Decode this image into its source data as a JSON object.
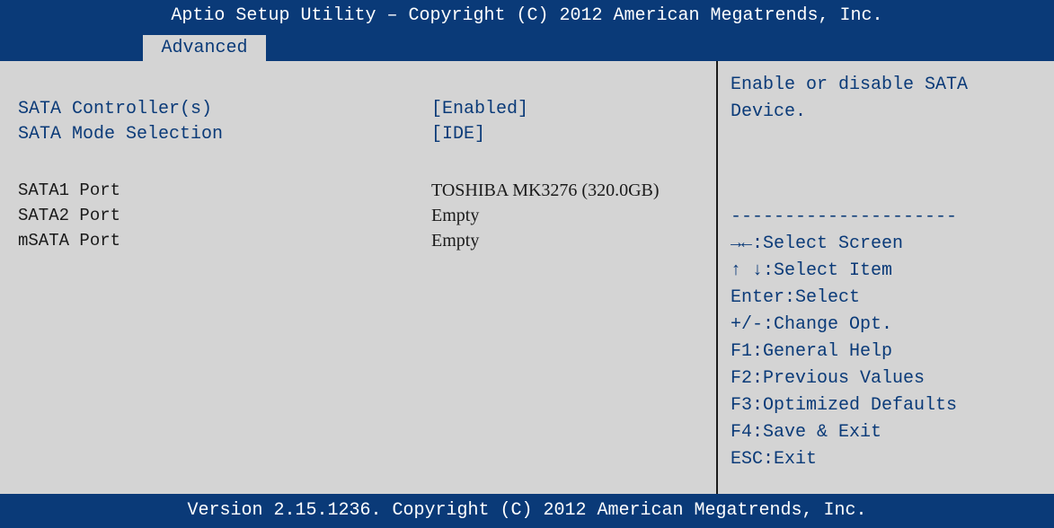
{
  "header": {
    "title": "Aptio Setup Utility – Copyright (C) 2012 American Megatrends, Inc."
  },
  "tabs": [
    {
      "label": "Advanced",
      "active": true
    }
  ],
  "settings": [
    {
      "label": "SATA Controller(s)",
      "value": "[Enabled]"
    },
    {
      "label": "SATA Mode Selection",
      "value": "[IDE]"
    }
  ],
  "ports": [
    {
      "label": "SATA1 Port",
      "value": "TOSHIBA MK3276 (320.0GB)"
    },
    {
      "label": "SATA2 Port",
      "value": "Empty"
    },
    {
      "label": "mSATA Port",
      "value": "Empty"
    }
  ],
  "help": {
    "text": "Enable or disable SATA\nDevice.",
    "separator": "---------------------",
    "keys": [
      {
        "key": "→←:",
        "desc": " Select Screen"
      },
      {
        "key": "↑ ↓:",
        "desc": " Select Item"
      },
      {
        "key": "Enter:",
        "desc": " Select"
      },
      {
        "key": "+/-:",
        "desc": "  Change Opt."
      },
      {
        "key": "F1:",
        "desc": "  General Help"
      },
      {
        "key": "F2:",
        "desc": "  Previous Values"
      },
      {
        "key": "F3:",
        "desc": "  Optimized Defaults"
      },
      {
        "key": "F4:",
        "desc": "  Save & Exit"
      },
      {
        "key": "ESC:",
        "desc": " Exit"
      }
    ]
  },
  "footer": {
    "text": "Version 2.15.1236. Copyright (C) 2012 American Megatrends, Inc."
  },
  "colors": {
    "bar": "#0a3a78",
    "panel": "#d4d4d4",
    "highlight_text": "#0a3a78",
    "info_text": "#1a1a1a"
  }
}
